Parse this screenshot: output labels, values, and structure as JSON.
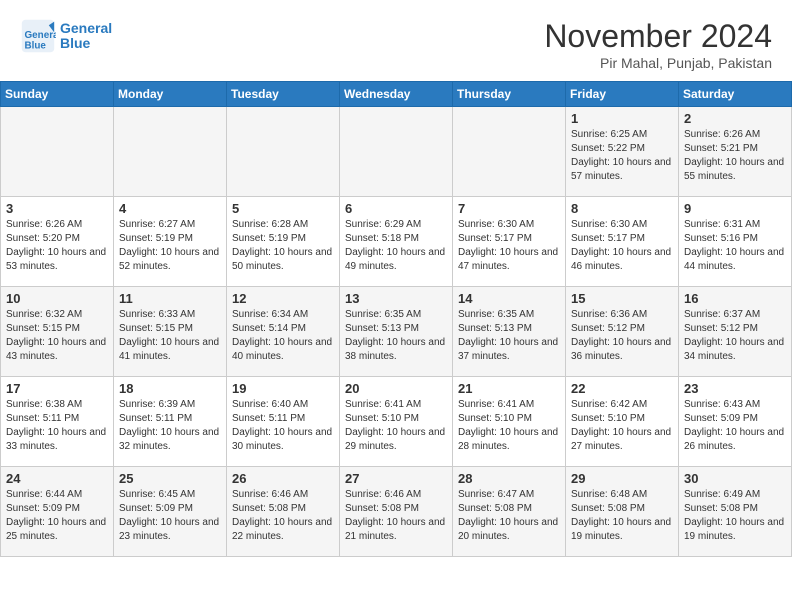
{
  "header": {
    "logo_line1": "General",
    "logo_line2": "Blue",
    "month_year": "November 2024",
    "location": "Pir Mahal, Punjab, Pakistan"
  },
  "weekdays": [
    "Sunday",
    "Monday",
    "Tuesday",
    "Wednesday",
    "Thursday",
    "Friday",
    "Saturday"
  ],
  "weeks": [
    [
      {
        "day": "",
        "info": ""
      },
      {
        "day": "",
        "info": ""
      },
      {
        "day": "",
        "info": ""
      },
      {
        "day": "",
        "info": ""
      },
      {
        "day": "",
        "info": ""
      },
      {
        "day": "1",
        "info": "Sunrise: 6:25 AM\nSunset: 5:22 PM\nDaylight: 10 hours and 57 minutes."
      },
      {
        "day": "2",
        "info": "Sunrise: 6:26 AM\nSunset: 5:21 PM\nDaylight: 10 hours and 55 minutes."
      }
    ],
    [
      {
        "day": "3",
        "info": "Sunrise: 6:26 AM\nSunset: 5:20 PM\nDaylight: 10 hours and 53 minutes."
      },
      {
        "day": "4",
        "info": "Sunrise: 6:27 AM\nSunset: 5:19 PM\nDaylight: 10 hours and 52 minutes."
      },
      {
        "day": "5",
        "info": "Sunrise: 6:28 AM\nSunset: 5:19 PM\nDaylight: 10 hours and 50 minutes."
      },
      {
        "day": "6",
        "info": "Sunrise: 6:29 AM\nSunset: 5:18 PM\nDaylight: 10 hours and 49 minutes."
      },
      {
        "day": "7",
        "info": "Sunrise: 6:30 AM\nSunset: 5:17 PM\nDaylight: 10 hours and 47 minutes."
      },
      {
        "day": "8",
        "info": "Sunrise: 6:30 AM\nSunset: 5:17 PM\nDaylight: 10 hours and 46 minutes."
      },
      {
        "day": "9",
        "info": "Sunrise: 6:31 AM\nSunset: 5:16 PM\nDaylight: 10 hours and 44 minutes."
      }
    ],
    [
      {
        "day": "10",
        "info": "Sunrise: 6:32 AM\nSunset: 5:15 PM\nDaylight: 10 hours and 43 minutes."
      },
      {
        "day": "11",
        "info": "Sunrise: 6:33 AM\nSunset: 5:15 PM\nDaylight: 10 hours and 41 minutes."
      },
      {
        "day": "12",
        "info": "Sunrise: 6:34 AM\nSunset: 5:14 PM\nDaylight: 10 hours and 40 minutes."
      },
      {
        "day": "13",
        "info": "Sunrise: 6:35 AM\nSunset: 5:13 PM\nDaylight: 10 hours and 38 minutes."
      },
      {
        "day": "14",
        "info": "Sunrise: 6:35 AM\nSunset: 5:13 PM\nDaylight: 10 hours and 37 minutes."
      },
      {
        "day": "15",
        "info": "Sunrise: 6:36 AM\nSunset: 5:12 PM\nDaylight: 10 hours and 36 minutes."
      },
      {
        "day": "16",
        "info": "Sunrise: 6:37 AM\nSunset: 5:12 PM\nDaylight: 10 hours and 34 minutes."
      }
    ],
    [
      {
        "day": "17",
        "info": "Sunrise: 6:38 AM\nSunset: 5:11 PM\nDaylight: 10 hours and 33 minutes."
      },
      {
        "day": "18",
        "info": "Sunrise: 6:39 AM\nSunset: 5:11 PM\nDaylight: 10 hours and 32 minutes."
      },
      {
        "day": "19",
        "info": "Sunrise: 6:40 AM\nSunset: 5:11 PM\nDaylight: 10 hours and 30 minutes."
      },
      {
        "day": "20",
        "info": "Sunrise: 6:41 AM\nSunset: 5:10 PM\nDaylight: 10 hours and 29 minutes."
      },
      {
        "day": "21",
        "info": "Sunrise: 6:41 AM\nSunset: 5:10 PM\nDaylight: 10 hours and 28 minutes."
      },
      {
        "day": "22",
        "info": "Sunrise: 6:42 AM\nSunset: 5:10 PM\nDaylight: 10 hours and 27 minutes."
      },
      {
        "day": "23",
        "info": "Sunrise: 6:43 AM\nSunset: 5:09 PM\nDaylight: 10 hours and 26 minutes."
      }
    ],
    [
      {
        "day": "24",
        "info": "Sunrise: 6:44 AM\nSunset: 5:09 PM\nDaylight: 10 hours and 25 minutes."
      },
      {
        "day": "25",
        "info": "Sunrise: 6:45 AM\nSunset: 5:09 PM\nDaylight: 10 hours and 23 minutes."
      },
      {
        "day": "26",
        "info": "Sunrise: 6:46 AM\nSunset: 5:08 PM\nDaylight: 10 hours and 22 minutes."
      },
      {
        "day": "27",
        "info": "Sunrise: 6:46 AM\nSunset: 5:08 PM\nDaylight: 10 hours and 21 minutes."
      },
      {
        "day": "28",
        "info": "Sunrise: 6:47 AM\nSunset: 5:08 PM\nDaylight: 10 hours and 20 minutes."
      },
      {
        "day": "29",
        "info": "Sunrise: 6:48 AM\nSunset: 5:08 PM\nDaylight: 10 hours and 19 minutes."
      },
      {
        "day": "30",
        "info": "Sunrise: 6:49 AM\nSunset: 5:08 PM\nDaylight: 10 hours and 19 minutes."
      }
    ]
  ]
}
